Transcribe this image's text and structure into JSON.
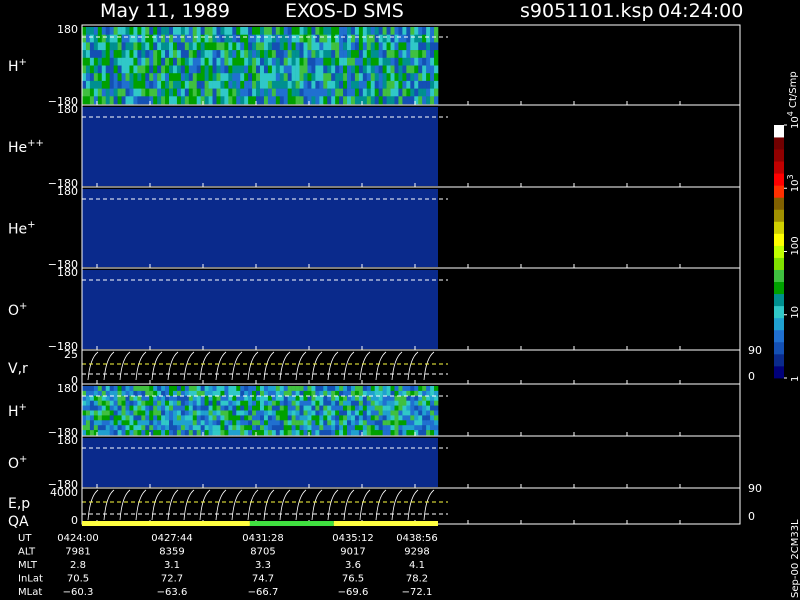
{
  "header": {
    "date": "May 11, 1989",
    "instrument": "EXOS-D SMS",
    "file": "s9051101.ksp",
    "time": "04:24:00"
  },
  "side_text": "Sep-00 2CM33L",
  "colors": {
    "background": "#000000",
    "frame": "#ffffff",
    "quicklook_line": "#ffff40",
    "spectrogram_fill": "#0a2a8c"
  },
  "chart_data": {
    "type": "heatmap",
    "panels": [
      {
        "name": "H",
        "superscript": "+",
        "ytick_top": "180",
        "ytick_bottom": "−180",
        "ylim": [
          -180,
          180
        ],
        "kind": "pitch-angle",
        "dominant_level": "high"
      },
      {
        "name": "He",
        "superscript": "++",
        "ytick_top": "180",
        "ytick_bottom": "−180",
        "ylim": [
          -180,
          180
        ],
        "kind": "pitch-angle",
        "dominant_level": "low"
      },
      {
        "name": "He",
        "superscript": "+",
        "ytick_top": "180",
        "ytick_bottom": "−180",
        "ylim": [
          -180,
          180
        ],
        "kind": "pitch-angle",
        "dominant_level": "low"
      },
      {
        "name": "O",
        "superscript": "+",
        "ytick_top": "180",
        "ytick_bottom": "−180",
        "ylim": [
          -180,
          180
        ],
        "kind": "pitch-angle",
        "dominant_level": "low"
      },
      {
        "name": "V,r",
        "superscript": "",
        "ytick_top": "25",
        "ytick_bottom": "0",
        "right_top": "90",
        "right_bottom": "0",
        "kind": "line"
      },
      {
        "name": "H",
        "superscript": "+",
        "ytick_top": "180",
        "ytick_bottom": "−180",
        "ylim": [
          -180,
          180
        ],
        "kind": "pitch-angle",
        "dominant_level": "medium"
      },
      {
        "name": "O",
        "superscript": "+",
        "ytick_top": "180",
        "ytick_bottom": "−180",
        "ylim": [
          -180,
          180
        ],
        "kind": "pitch-angle",
        "dominant_level": "low"
      },
      {
        "name": "E,p",
        "name2": "QA",
        "superscript": "",
        "ytick_top": "4000",
        "ytick_bottom": "0",
        "right_top": "90",
        "right_bottom": "0",
        "kind": "line"
      }
    ],
    "colorbar": {
      "label": "Ct/Smp",
      "ticks": [
        {
          "label": "1",
          "value": 1
        },
        {
          "label": "10",
          "value": 10
        },
        {
          "label": "100",
          "value": 100
        },
        {
          "label": "10",
          "exp": "3",
          "value": 1000
        },
        {
          "label": "10",
          "exp": "4",
          "value": 10000
        }
      ],
      "colors": [
        "#00007a",
        "#0a2a8c",
        "#1450b4",
        "#2070d0",
        "#20a0d0",
        "#30c8c8",
        "#009090",
        "#00a000",
        "#40c040",
        "#80e000",
        "#c0ff00",
        "#ffff00",
        "#d0d000",
        "#a09000",
        "#806000",
        "#ff3000",
        "#ff0000",
        "#c00000",
        "#900000",
        "#700000",
        "#ffffff"
      ]
    },
    "qa_bar": [
      {
        "from": "0424:00",
        "to": "0431:28",
        "color": "#ffff40"
      },
      {
        "from": "0431:28",
        "to": "0435:12",
        "color": "#40e040"
      },
      {
        "from": "0435:12",
        "to": "0439:50",
        "color": "#ffff40"
      }
    ],
    "x_times": [
      "0424:00",
      "0427:44",
      "0431:28",
      "0435:12",
      "0438:56"
    ],
    "ephemeris": {
      "labels": [
        "UT",
        "ALT",
        "MLT",
        "InLat",
        "MLat"
      ],
      "values": [
        [
          "0424:00",
          "0427:44",
          "0431:28",
          "0435:12",
          "0438:56"
        ],
        [
          "7981",
          "8359",
          "8705",
          "9017",
          "9298"
        ],
        [
          "2.8",
          "3.1",
          "3.3",
          "3.6",
          "4.1"
        ],
        [
          "70.5",
          "72.7",
          "74.7",
          "76.5",
          "78.2"
        ],
        [
          "−60.3",
          "−63.6",
          "−66.7",
          "−69.6",
          "−72.1"
        ]
      ]
    }
  }
}
